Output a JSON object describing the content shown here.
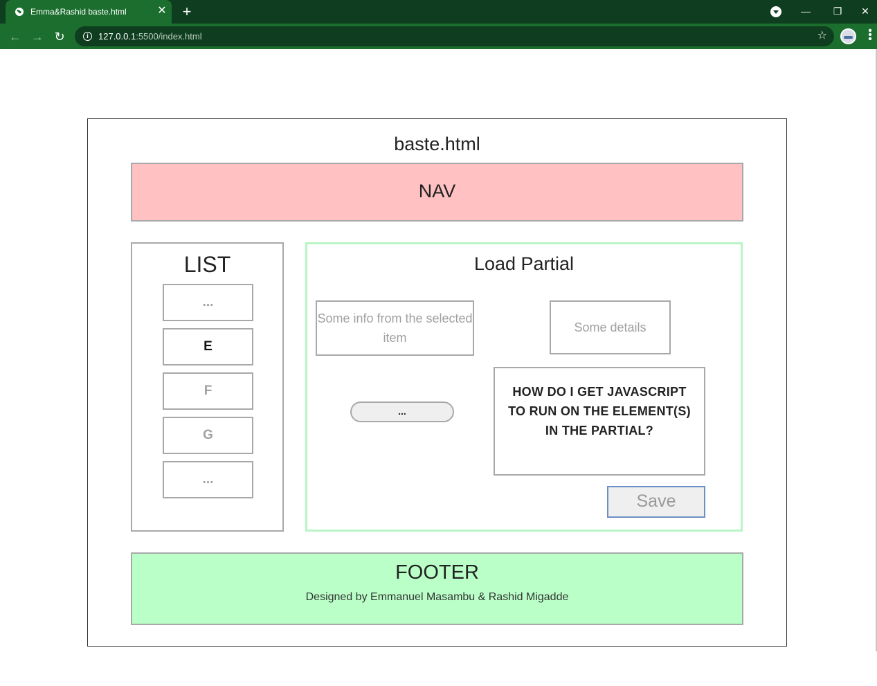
{
  "browser": {
    "tab_title": "Emma&Rashid baste.html",
    "tab_close": "✕",
    "new_tab": "+",
    "url_host": "127.0.0.1",
    "url_path": ":5500/index.html",
    "window_controls": {
      "minimize": "—",
      "restore": "❐",
      "close": "✕"
    },
    "icons": {
      "back": "back-arrow-icon",
      "forward": "forward-arrow-icon",
      "reload": "reload-icon",
      "info": "site-info-icon",
      "star": "bookmark-star-icon",
      "menu": "kebab-menu-icon"
    }
  },
  "page": {
    "title": "baste.html",
    "nav": "NAV",
    "list": {
      "title": "LIST",
      "items": [
        {
          "label": "...",
          "active": false
        },
        {
          "label": "E",
          "active": true
        },
        {
          "label": "F",
          "active": false
        },
        {
          "label": "G",
          "active": false
        },
        {
          "label": "...",
          "active": false
        }
      ]
    },
    "partial": {
      "title": "Load Partial",
      "info_text": "Some info from the selected item",
      "details_text": "Some details",
      "pill_button": "...",
      "question": "HOW DO I GET JAVASCRIPT TO RUN ON THE ELEMENT(S) IN THE PARTIAL?",
      "save_button": "Save"
    },
    "footer": {
      "title": "FOOTER",
      "credit": "Designed by Emmanuel Masambu & Rashid Migadde"
    }
  },
  "colors": {
    "chrome_dark": "#0f3d1f",
    "chrome_light": "#1b6e2e",
    "nav_bg": "#ffc1c1",
    "footer_bg": "#b9ffc7",
    "partial_border": "#b8f5c6",
    "save_border": "#6e8fc4"
  }
}
